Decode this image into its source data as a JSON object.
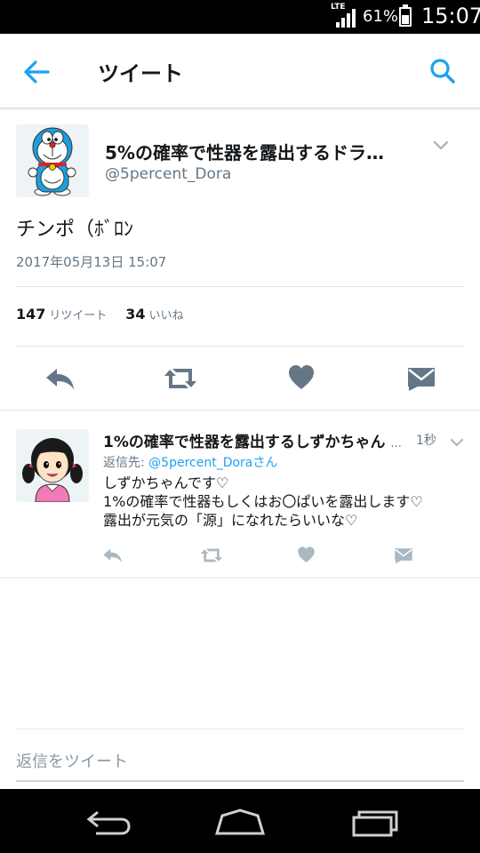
{
  "status_bar": {
    "network": "LTE",
    "battery_percent": "61%",
    "battery_level": 0.61,
    "time": "15:07"
  },
  "header": {
    "title": "ツイート",
    "back_icon": "arrow-left-icon",
    "search_icon": "search-icon"
  },
  "main_tweet": {
    "display_name": "5%の確率で性器を露出するドラ…",
    "handle": "@5percent_Dora",
    "text": "チンポ（ﾎﾞﾛﾝ",
    "timestamp": "2017年05月13日 15:07",
    "retweet_count": "147",
    "retweet_label": "リツイート",
    "like_count": "34",
    "like_label": "いいね",
    "actions": [
      "reply-icon",
      "retweet-icon",
      "heart-icon",
      "dm-icon"
    ]
  },
  "reply_tweet": {
    "display_name": "1%の確率で性器を露出するしずかちゃん",
    "handle_tail": "...",
    "time": "1秒",
    "reply_to_prefix": "返信先:",
    "reply_to_user": "@5percent_Doraさん",
    "text": "しずかちゃんです♡\n1%の確率で性器もしくはお〇ぱいを露出します♡\n露出が元気の「源」になれたらいいな♡"
  },
  "compose": {
    "placeholder": "返信をツイート"
  },
  "nav_bar": {
    "icons": [
      "back-nav-icon",
      "home-nav-icon",
      "recents-nav-icon"
    ]
  },
  "colors": {
    "accent": "#1da1f2",
    "icon_gray": "#657786",
    "light_icon": "#aab8c2"
  }
}
